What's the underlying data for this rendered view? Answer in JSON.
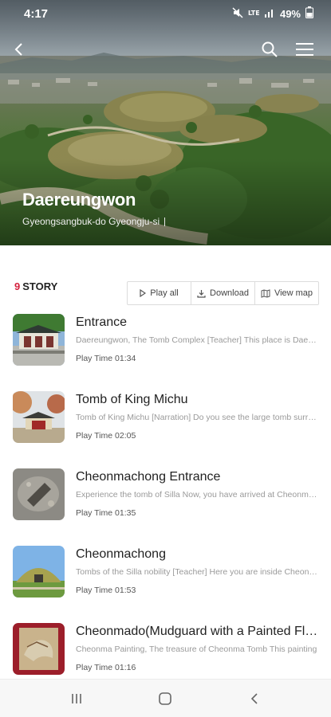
{
  "status_bar": {
    "time": "4:17",
    "battery": "49%"
  },
  "hero": {
    "title": "Daereungwon",
    "subtitle": "Gyeongsangbuk-do Gyeongju-si"
  },
  "story": {
    "count": "9",
    "label": "STORY"
  },
  "actions": {
    "play_all": "Play all",
    "download": "Download",
    "view_map": "View map"
  },
  "items": [
    {
      "title": "Entrance",
      "desc": "Daereungwon, The Tomb Complex [Teacher] This place is Daereungwon",
      "time": "Play Time 01:34"
    },
    {
      "title": "Tomb of King Michu",
      "desc": "Tomb of King Michu [Narration] Do you see the large tomb surrounded",
      "time": "Play Time 02:05"
    },
    {
      "title": "Cheonmachong Entrance",
      "desc": "Experience the tomb of Silla Now, you have arrived at Cheonmachong",
      "time": "Play Time 01:35"
    },
    {
      "title": "Cheonmachong",
      "desc": "Tombs of the Silla nobility [Teacher] Here you are inside Cheonmachong",
      "time": "Play Time 01:53"
    },
    {
      "title": "Cheonmado(Mudguard with a Painted Flying Horse)",
      "desc": "Cheonma Painting, The treasure of Cheonma Tomb This painting",
      "time": "Play Time 01:16"
    }
  ],
  "colors": {
    "accent": "#d4213d"
  }
}
